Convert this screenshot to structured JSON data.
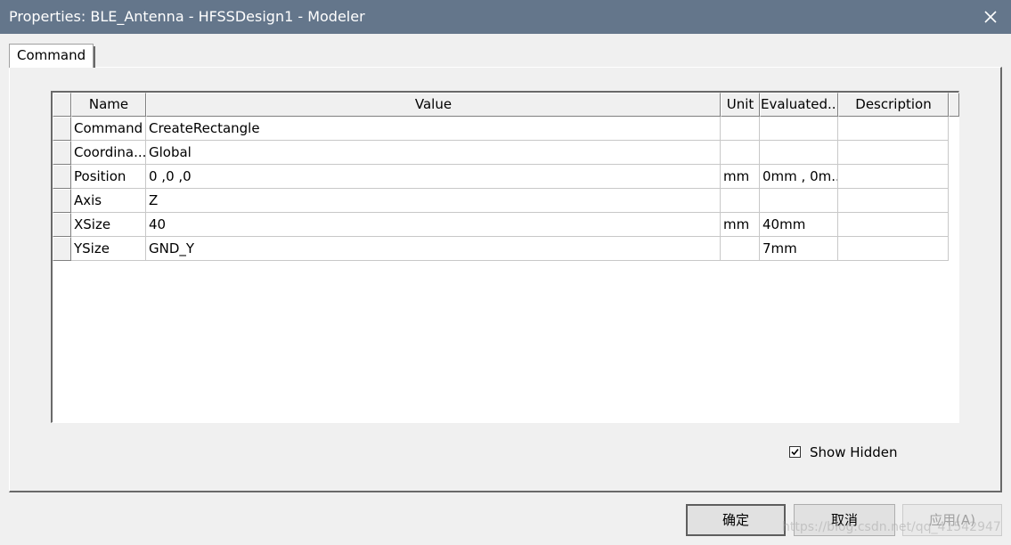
{
  "window": {
    "title": "Properties: BLE_Antenna - HFSSDesign1 - Modeler"
  },
  "tabs": [
    {
      "label": "Command"
    }
  ],
  "table": {
    "columns": [
      "Name",
      "Value",
      "Unit",
      "Evaluated...",
      "Description"
    ],
    "rows": [
      {
        "name": "Command",
        "value": "CreateRectangle",
        "unit": "",
        "evaluated": "",
        "description": ""
      },
      {
        "name": "Coordina...",
        "value": "Global",
        "unit": "",
        "evaluated": "",
        "description": ""
      },
      {
        "name": "Position",
        "value": "0 ,0 ,0",
        "unit": "mm",
        "evaluated": "0mm , 0m...",
        "description": ""
      },
      {
        "name": "Axis",
        "value": "Z",
        "unit": "",
        "evaluated": "",
        "description": ""
      },
      {
        "name": "XSize",
        "value": "40",
        "unit": "mm",
        "evaluated": "40mm",
        "description": ""
      },
      {
        "name": "YSize",
        "value": "GND_Y",
        "unit": "",
        "evaluated": "7mm",
        "description": ""
      }
    ]
  },
  "show_hidden": {
    "label": "Show Hidden",
    "checked": true
  },
  "buttons": {
    "ok": "确定",
    "cancel": "取消",
    "apply": "应用(A)"
  },
  "watermark": "https://blog.csdn.net/qq_41542947"
}
